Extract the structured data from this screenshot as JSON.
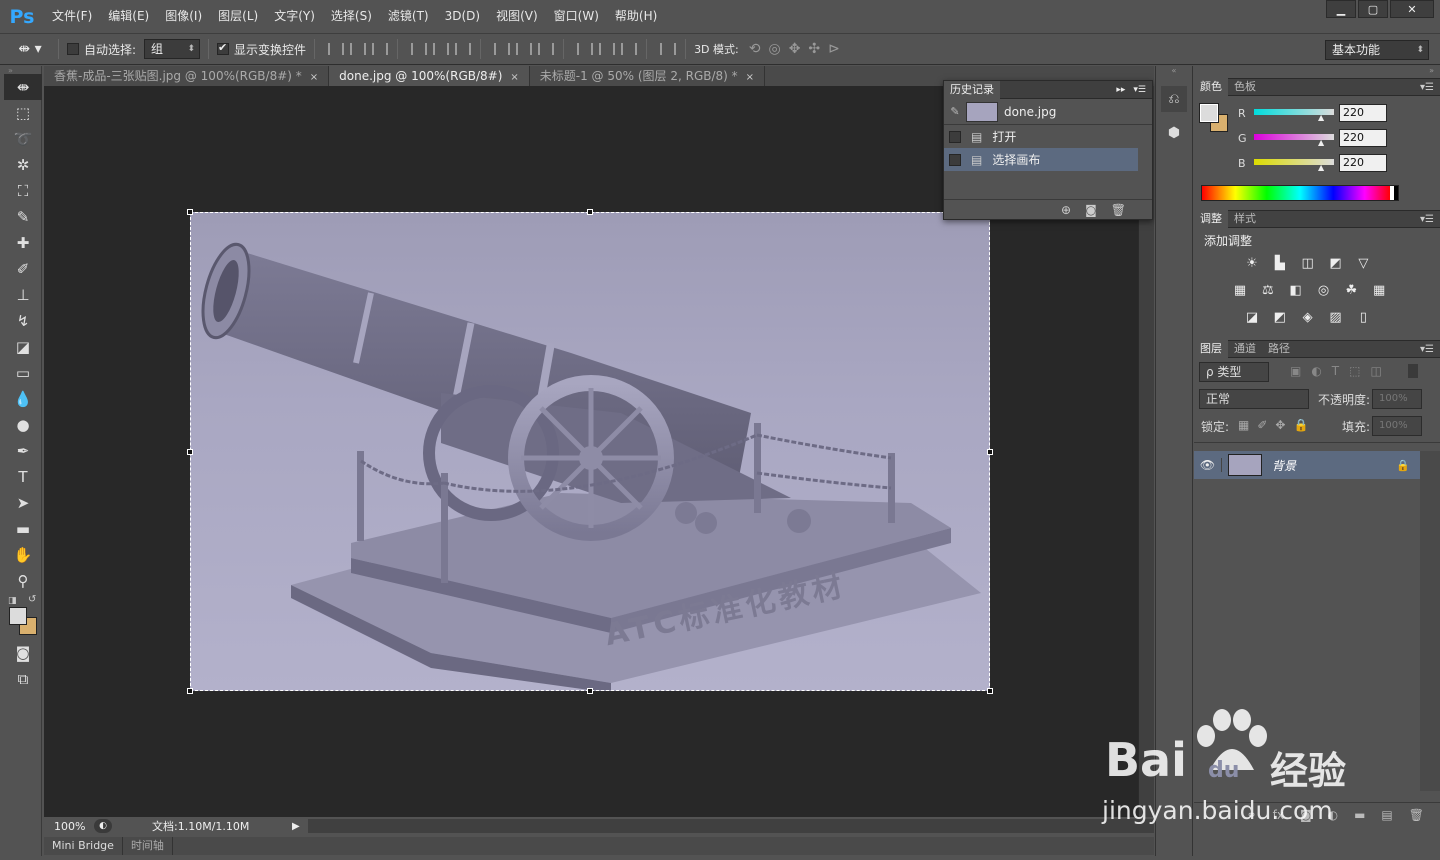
{
  "menubar": {
    "logo": "Ps",
    "items": [
      "文件(F)",
      "编辑(E)",
      "图像(I)",
      "图层(L)",
      "文字(Y)",
      "选择(S)",
      "滤镜(T)",
      "3D(D)",
      "视图(V)",
      "窗口(W)",
      "帮助(H)"
    ],
    "window_controls": [
      "▁",
      "▢",
      "✕"
    ]
  },
  "options": {
    "auto_select_label": "自动选择:",
    "auto_select_value": "组",
    "show_transform_label": "显示变换控件",
    "mode_3d_label": "3D 模式:",
    "workspace": "基本功能"
  },
  "tabs": [
    {
      "label": "香蕉-成品-三张贴图.jpg @ 100%(RGB/8#) *",
      "close": "×"
    },
    {
      "label": "done.jpg @ 100%(RGB/8#)",
      "close": "×"
    },
    {
      "label": "未标题-1 @ 50% (图层 2, RGB/8) *",
      "close": "×"
    }
  ],
  "history": {
    "tabs": [
      "历史记录"
    ],
    "snapshot": "done.jpg",
    "steps": [
      "打开",
      "选择画布"
    ]
  },
  "image": {
    "engraving": "ATC标准化教材"
  },
  "color_panel": {
    "tabs": [
      "颜色",
      "色板"
    ],
    "channels": [
      {
        "label": "R",
        "value": "220",
        "color": "#00e5e5"
      },
      {
        "label": "G",
        "value": "220",
        "color": "#e000e0"
      },
      {
        "label": "B",
        "value": "220",
        "color": "#e0e000"
      }
    ],
    "foreground": "#dcdcdc",
    "background": "#d9b06e"
  },
  "adjust_panel": {
    "tabs": [
      "调整",
      "样式"
    ],
    "title": "添加调整",
    "row1": [
      "☀",
      "▙",
      "◫",
      "◩",
      "▽"
    ],
    "row2": [
      "▦",
      "⚖",
      "◧",
      "◎",
      "☘",
      "▦"
    ],
    "row3": [
      "◪",
      "◩",
      "◈",
      "▨",
      "▯"
    ]
  },
  "layers_panel": {
    "tabs": [
      "图层",
      "通道",
      "路径"
    ],
    "filter_label": "ρ 类型",
    "blend_mode": "正常",
    "opacity_label": "不透明度:",
    "opacity_value": "100%",
    "lock_label": "锁定:",
    "fill_label": "填充:",
    "fill_value": "100%",
    "layers": [
      {
        "name": "背景",
        "visible": true,
        "locked": true
      }
    ]
  },
  "status": {
    "zoom": "100%",
    "doc_info": "文档:1.10M/1.10M"
  },
  "bottom_tabs": [
    "Mini Bridge",
    "时间轴"
  ],
  "watermark": {
    "brand": "Bai",
    "du": "du",
    "product": "经验",
    "url": "jingyan.baidu.com"
  }
}
